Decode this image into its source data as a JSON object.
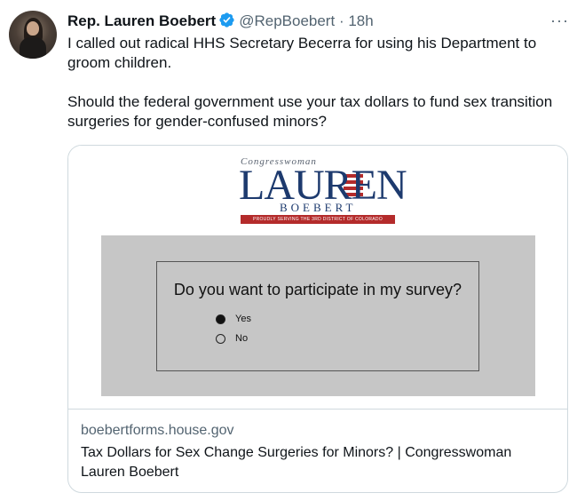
{
  "tweet": {
    "author_name": "Rep. Lauren Boebert",
    "handle": "@RepBoebert",
    "separator": "·",
    "time": "18h",
    "more_label": "···",
    "text_p1": "I called out radical HHS Secretary Becerra for using his Department to groom children.",
    "text_p2": "Should the federal government use your tax dollars to fund sex transition surgeries for gender-confused minors?"
  },
  "card": {
    "logo": {
      "congresswoman": "Congresswoman",
      "lauren": "LAUREN",
      "boebert": "BOEBERT",
      "banner": "PROUDLY SERVING THE 3RD DISTRICT OF COLORADO"
    },
    "survey": {
      "question": "Do you want to participate in my survey?",
      "options": [
        {
          "label": "Yes",
          "selected": true
        },
        {
          "label": "No",
          "selected": false
        }
      ]
    },
    "domain": "boebertforms.house.gov",
    "title": "Tax Dollars for Sex Change Surgeries for Minors? | Congresswoman Lauren Boebert"
  },
  "colors": {
    "verified": "#1d9bf0",
    "logo_navy": "#1d3a6e",
    "logo_red": "#b42b2b",
    "survey_bg": "#c6c6c6"
  }
}
